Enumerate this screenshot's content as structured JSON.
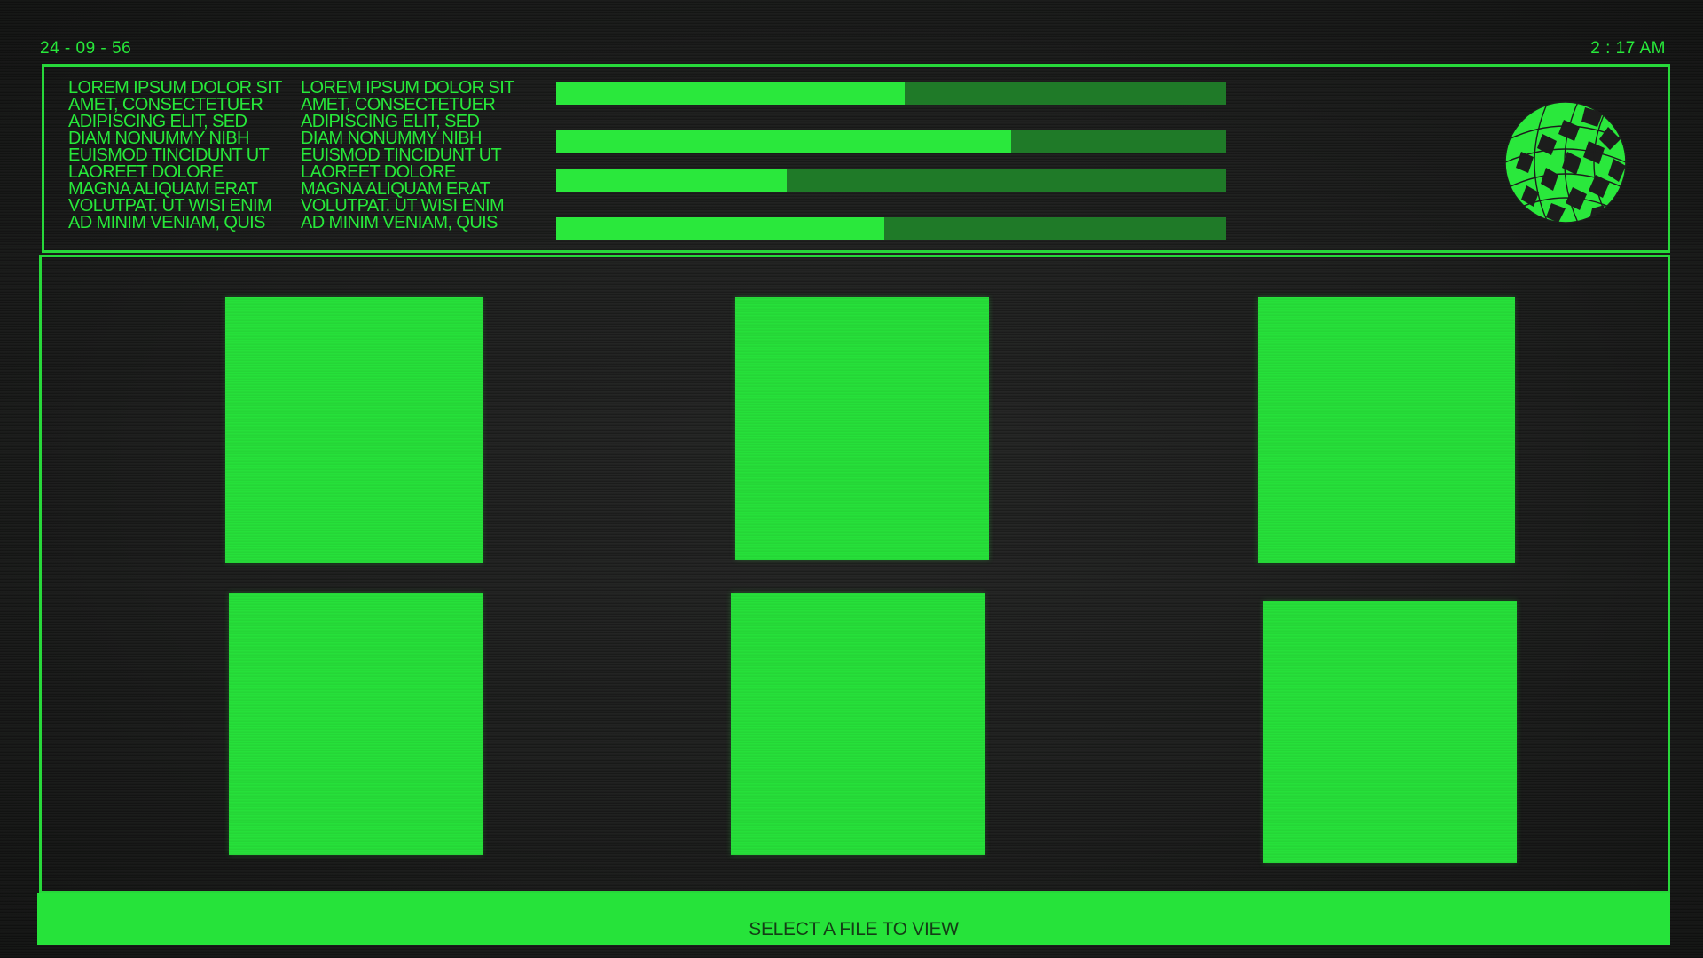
{
  "header": {
    "date": "24 - 09 - 56",
    "time": "2 : 17 AM"
  },
  "info_panel": {
    "column_1": "LOREM IPSUM DOLOR SIT\nAMET, CONSECTETUER\nADIPISCING ELIT, SED\nDIAM NONUMMY NIBH\nEUISMOD TINCIDUNT UT\nLAOREET DOLORE\nMAGNA ALIQUAM ERAT\nVOLUTPAT. UT WISI ENIM\nAD MINIM VENIAM, QUIS",
    "column_2": "LOREM IPSUM DOLOR SIT\nAMET, CONSECTETUER\nADIPISCING ELIT, SED\nDIAM NONUMMY NIBH\nEUISMOD TINCIDUNT UT\nLAOREET DOLORE\nMAGNA ALIQUAM ERAT\nVOLUTPAT. UT WISI ENIM\nAD MINIM VENIAM, QUIS",
    "meters": [
      {
        "level": 0.52
      },
      {
        "level": 0.68
      },
      {
        "level": 0.345
      },
      {
        "level": 0.49
      }
    ],
    "globe_icon": "globe-icon"
  },
  "files": {
    "count": 6
  },
  "status_bar": {
    "text": "SELECT A FILE TO VIEW"
  },
  "colors": {
    "accent": "#27e83a",
    "meter_track": "#1f7a28",
    "background": "#1c1d1c"
  }
}
